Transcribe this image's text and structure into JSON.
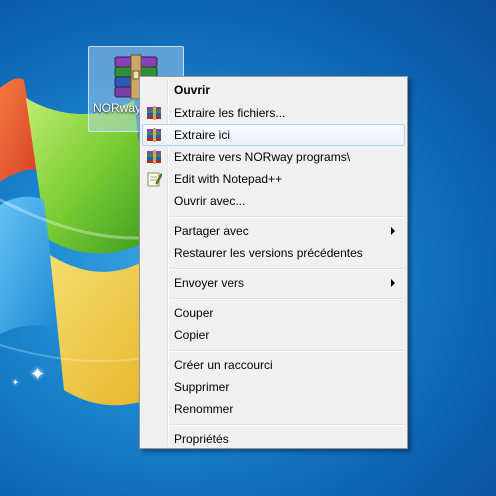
{
  "desktop_icon": {
    "label": "NORway programs"
  },
  "context_menu": {
    "items": [
      {
        "label": "Ouvrir"
      },
      {
        "label": "Extraire les fichiers..."
      },
      {
        "label": "Extraire ici"
      },
      {
        "label": "Extraire vers NORway programs\\"
      },
      {
        "label": "Edit with Notepad++"
      },
      {
        "label": "Ouvrir avec..."
      },
      {
        "label": "Partager avec"
      },
      {
        "label": "Restaurer les versions précédentes"
      },
      {
        "label": "Envoyer vers"
      },
      {
        "label": "Couper"
      },
      {
        "label": "Copier"
      },
      {
        "label": "Créer un raccourci"
      },
      {
        "label": "Supprimer"
      },
      {
        "label": "Renommer"
      },
      {
        "label": "Propriétés"
      }
    ],
    "highlighted": "Extraire ici",
    "icons": [
      "winrar-icon",
      "winrar-icon",
      "winrar-icon",
      "notepadpp-icon"
    ]
  },
  "colors": {
    "desktop_blue": "#1a86cf",
    "menu_bg": "#f0f0f0",
    "highlight_border": "#aecff7"
  }
}
